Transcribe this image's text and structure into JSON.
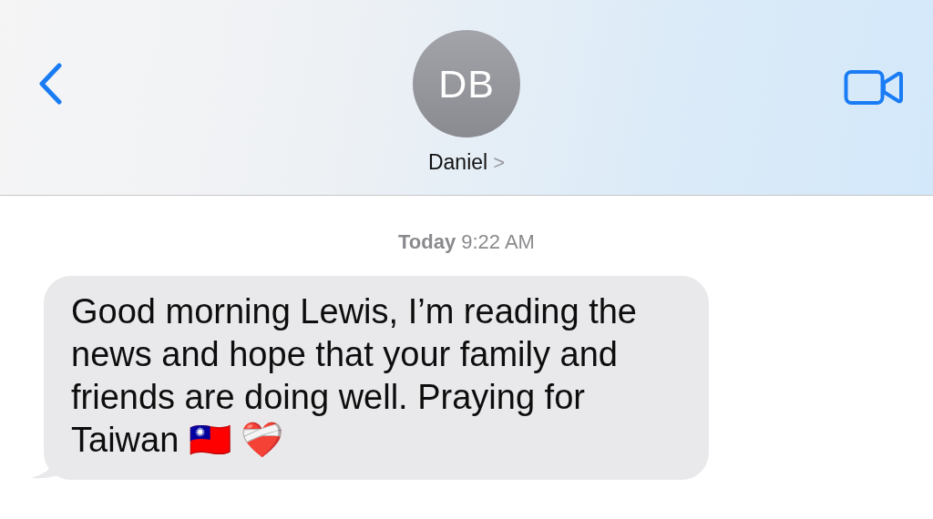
{
  "header": {
    "avatar_initials": "DB",
    "contact_name": "Daniel",
    "name_chevron": ">"
  },
  "timestamp": {
    "day": "Today",
    "time": "9:22 AM"
  },
  "messages": [
    {
      "kind": "incoming",
      "text": "Good morning Lewis, I’m reading the news and hope that your family and friends are doing well. Praying for Taiwan 🇹🇼 ❤️‍🩹"
    }
  ]
}
